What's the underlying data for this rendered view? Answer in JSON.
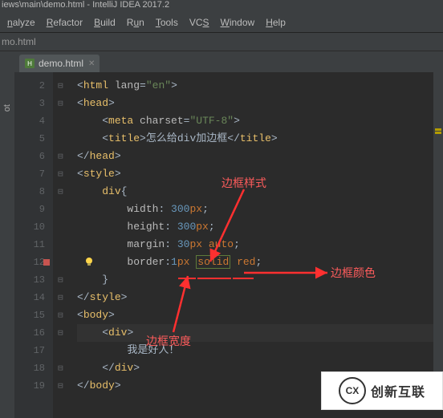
{
  "titlebar": "iews\\main\\demo.html - IntelliJ IDEA 2017.2",
  "menu": [
    "nalyze",
    "Refactor",
    "Build",
    "Run",
    "Tools",
    "VCS",
    "Window",
    "Help"
  ],
  "breadcrumb": "mo.html",
  "tab": {
    "filename": "demo.html"
  },
  "lefttool": "ot",
  "code": {
    "lines": [
      {
        "n": 2,
        "fold": "⊟",
        "html": [
          [
            "t-punc",
            "<"
          ],
          [
            "t-tag",
            "html "
          ],
          [
            "t-attr",
            "lang"
          ],
          [
            "t-punc",
            "="
          ],
          [
            "t-str",
            "\"en\""
          ],
          [
            "t-punc",
            ">"
          ]
        ]
      },
      {
        "n": 3,
        "fold": "⊟",
        "html": [
          [
            "t-punc",
            "<"
          ],
          [
            "t-tag",
            "head"
          ],
          [
            "t-punc",
            ">"
          ]
        ]
      },
      {
        "n": 4,
        "fold": "",
        "indent": "    ",
        "html": [
          [
            "t-punc",
            "<"
          ],
          [
            "t-tag",
            "meta "
          ],
          [
            "t-attr",
            "charset"
          ],
          [
            "t-punc",
            "="
          ],
          [
            "t-str",
            "\"UTF-8\""
          ],
          [
            "t-punc",
            ">"
          ]
        ]
      },
      {
        "n": 5,
        "fold": "",
        "indent": "    ",
        "html": [
          [
            "t-punc",
            "<"
          ],
          [
            "t-tag",
            "title"
          ],
          [
            "t-punc",
            ">"
          ],
          [
            "t-text",
            "怎么给div加边框"
          ],
          [
            "t-punc",
            "</"
          ],
          [
            "t-tag",
            "title"
          ],
          [
            "t-punc",
            ">"
          ]
        ]
      },
      {
        "n": 6,
        "fold": "⊟",
        "html": [
          [
            "t-punc",
            "</"
          ],
          [
            "t-tag",
            "head"
          ],
          [
            "t-punc",
            ">"
          ]
        ]
      },
      {
        "n": 7,
        "fold": "⊟",
        "html": [
          [
            "t-punc",
            "<"
          ],
          [
            "t-tag",
            "style"
          ],
          [
            "t-punc",
            ">"
          ]
        ]
      },
      {
        "n": 8,
        "fold": "⊟",
        "indent": "    ",
        "html": [
          [
            "t-sel",
            "div"
          ],
          [
            "t-punc",
            "{"
          ]
        ]
      },
      {
        "n": 9,
        "fold": "",
        "indent": "        ",
        "html": [
          [
            "t-attr",
            "width"
          ],
          [
            "t-punc",
            ": "
          ],
          [
            "t-num",
            "300"
          ],
          [
            "t-kw",
            "px"
          ],
          [
            "t-punc",
            ";"
          ]
        ]
      },
      {
        "n": 10,
        "fold": "",
        "indent": "        ",
        "html": [
          [
            "t-attr",
            "height"
          ],
          [
            "t-punc",
            ": "
          ],
          [
            "t-num",
            "300"
          ],
          [
            "t-kw",
            "px"
          ],
          [
            "t-punc",
            ";"
          ]
        ]
      },
      {
        "n": 11,
        "fold": "",
        "indent": "        ",
        "html": [
          [
            "t-attr",
            "margin"
          ],
          [
            "t-punc",
            ": "
          ],
          [
            "t-num",
            "30"
          ],
          [
            "t-kw",
            "px "
          ],
          [
            "t-kw",
            "auto"
          ],
          [
            "t-punc",
            ";"
          ]
        ]
      },
      {
        "n": 12,
        "fold": "",
        "indent": "        ",
        "html": [
          [
            "t-attr",
            "border"
          ],
          [
            "t-punc",
            ":"
          ],
          [
            "t-num",
            "1"
          ],
          [
            "t-kw",
            "px "
          ],
          [
            "hl-box t-kw",
            "solid"
          ],
          [
            "t-kw",
            " red"
          ],
          [
            "t-punc",
            ";"
          ]
        ]
      },
      {
        "n": 13,
        "fold": "⊟",
        "indent": "    ",
        "html": [
          [
            "t-punc",
            "}"
          ]
        ]
      },
      {
        "n": 14,
        "fold": "⊟",
        "html": [
          [
            "t-punc",
            "</"
          ],
          [
            "t-tag",
            "style"
          ],
          [
            "t-punc",
            ">"
          ]
        ]
      },
      {
        "n": 15,
        "fold": "⊟",
        "html": [
          [
            "t-punc",
            "<"
          ],
          [
            "t-tag",
            "body"
          ],
          [
            "t-punc",
            ">"
          ]
        ]
      },
      {
        "n": 16,
        "fold": "⊟",
        "indent": "    ",
        "html": [
          [
            "t-punc",
            "<"
          ],
          [
            "t-tag",
            "div"
          ],
          [
            "t-punc",
            ">"
          ]
        ]
      },
      {
        "n": 17,
        "fold": "",
        "indent": "        ",
        "html": [
          [
            "t-text",
            "我是好人！"
          ]
        ]
      },
      {
        "n": 18,
        "fold": "⊟",
        "indent": "    ",
        "html": [
          [
            "t-punc",
            "</"
          ],
          [
            "t-tag",
            "div"
          ],
          [
            "t-punc",
            ">"
          ]
        ]
      },
      {
        "n": 19,
        "fold": "⊟",
        "html": [
          [
            "t-punc",
            "</"
          ],
          [
            "t-tag",
            "body"
          ],
          [
            "t-punc",
            ">"
          ]
        ]
      }
    ]
  },
  "annotations": {
    "style_label": "边框样式",
    "color_label": "边框颜色",
    "width_label": "边框宽度"
  },
  "watermark": "创新互联"
}
